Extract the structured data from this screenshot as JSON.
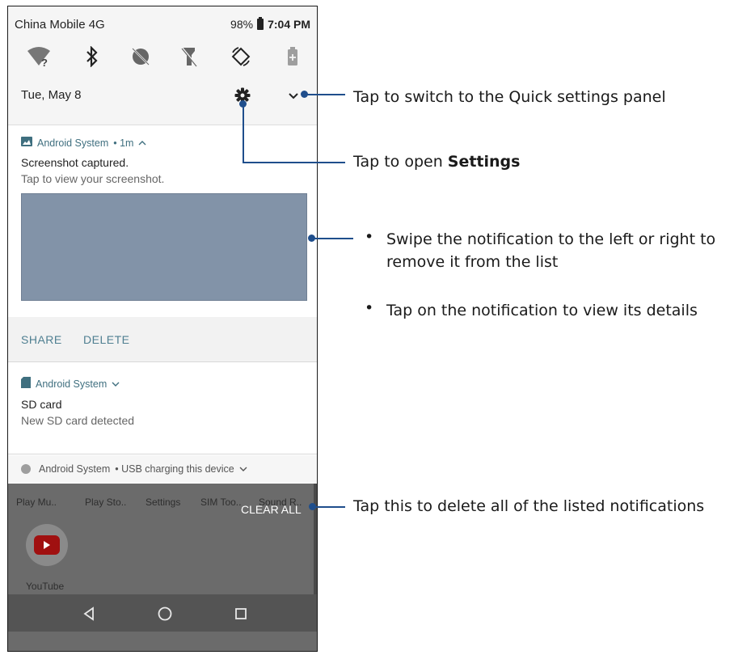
{
  "status_bar": {
    "carrier": "China Mobile 4G",
    "battery": "98%",
    "time": "7:04 PM"
  },
  "quick_icons": [
    "wifi-unknown-icon",
    "bluetooth-icon",
    "do-not-disturb-icon",
    "flashlight-off-icon",
    "auto-rotate-icon",
    "battery-saver-icon"
  ],
  "shade": {
    "date": "Tue, May 8"
  },
  "notifications": [
    {
      "app": "Android System",
      "time": "• 1m",
      "title": "Screenshot captured.",
      "text": "Tap to view your screenshot.",
      "actions": [
        "SHARE",
        "DELETE"
      ]
    },
    {
      "app": "Android System",
      "title": "SD card",
      "text": "New SD card detected"
    },
    {
      "app": "Android System",
      "text": "• USB charging this device"
    }
  ],
  "launcher": {
    "apps": [
      "Play Mu..",
      "Play Sto..",
      "Settings",
      "SIM Too..",
      "Sound R.."
    ],
    "clear_all": "CLEAR ALL",
    "youtube_label": "YouTube"
  },
  "callouts": {
    "quick_settings": "Tap to switch to the Quick settings panel",
    "settings_prefix": "Tap to open ",
    "settings_bold": "Settings",
    "swipe_line1": "Swipe the notification to the left or right to",
    "swipe_line2": "remove it from the list",
    "tap_details": "Tap on the notification to view its details",
    "clear_all": "Tap this to delete all of the listed notifications"
  },
  "colors": {
    "callout_line": "#1f4e8c",
    "screenshot_preview": "#8293a8",
    "link_text": "#4f7f91"
  }
}
